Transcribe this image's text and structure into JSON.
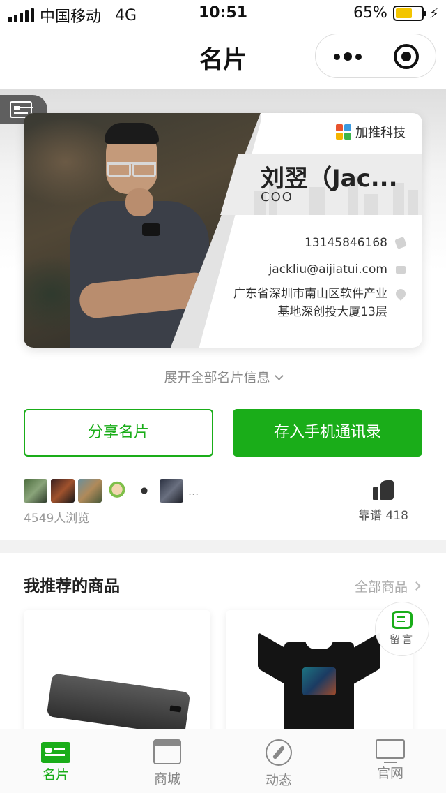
{
  "status_bar": {
    "carrier": "中国移动",
    "network": "4G",
    "time": "10:51",
    "battery": "65%",
    "battery_level": 0.65
  },
  "nav": {
    "title": "名片"
  },
  "card": {
    "company": "加推科技",
    "name": "刘翌（Jac...",
    "title": "COO",
    "phone": "13145846168",
    "email": "jackliu@aijiatui.com",
    "address": "广东省深圳市南山区软件产业基地深创投大厦13层"
  },
  "expand_label": "展开全部名片信息",
  "buttons": {
    "share": "分享名片",
    "save_contact": "存入手机通讯录"
  },
  "visitors": {
    "ellipsis": "...",
    "views": "4549人浏览"
  },
  "like": {
    "label": "靠谱 418"
  },
  "recommended": {
    "title": "我推荐的商品",
    "all_label": "全部商品"
  },
  "message_button": {
    "label": "留言"
  },
  "tabs": [
    {
      "label": "名片",
      "icon": "card-icon",
      "active": true
    },
    {
      "label": "商城",
      "icon": "shop-icon",
      "active": false
    },
    {
      "label": "动态",
      "icon": "compass-icon",
      "active": false
    },
    {
      "label": "官网",
      "icon": "desktop-icon",
      "active": false
    }
  ],
  "colors": {
    "accent": "#1aad19",
    "battery": "#f3c500"
  }
}
